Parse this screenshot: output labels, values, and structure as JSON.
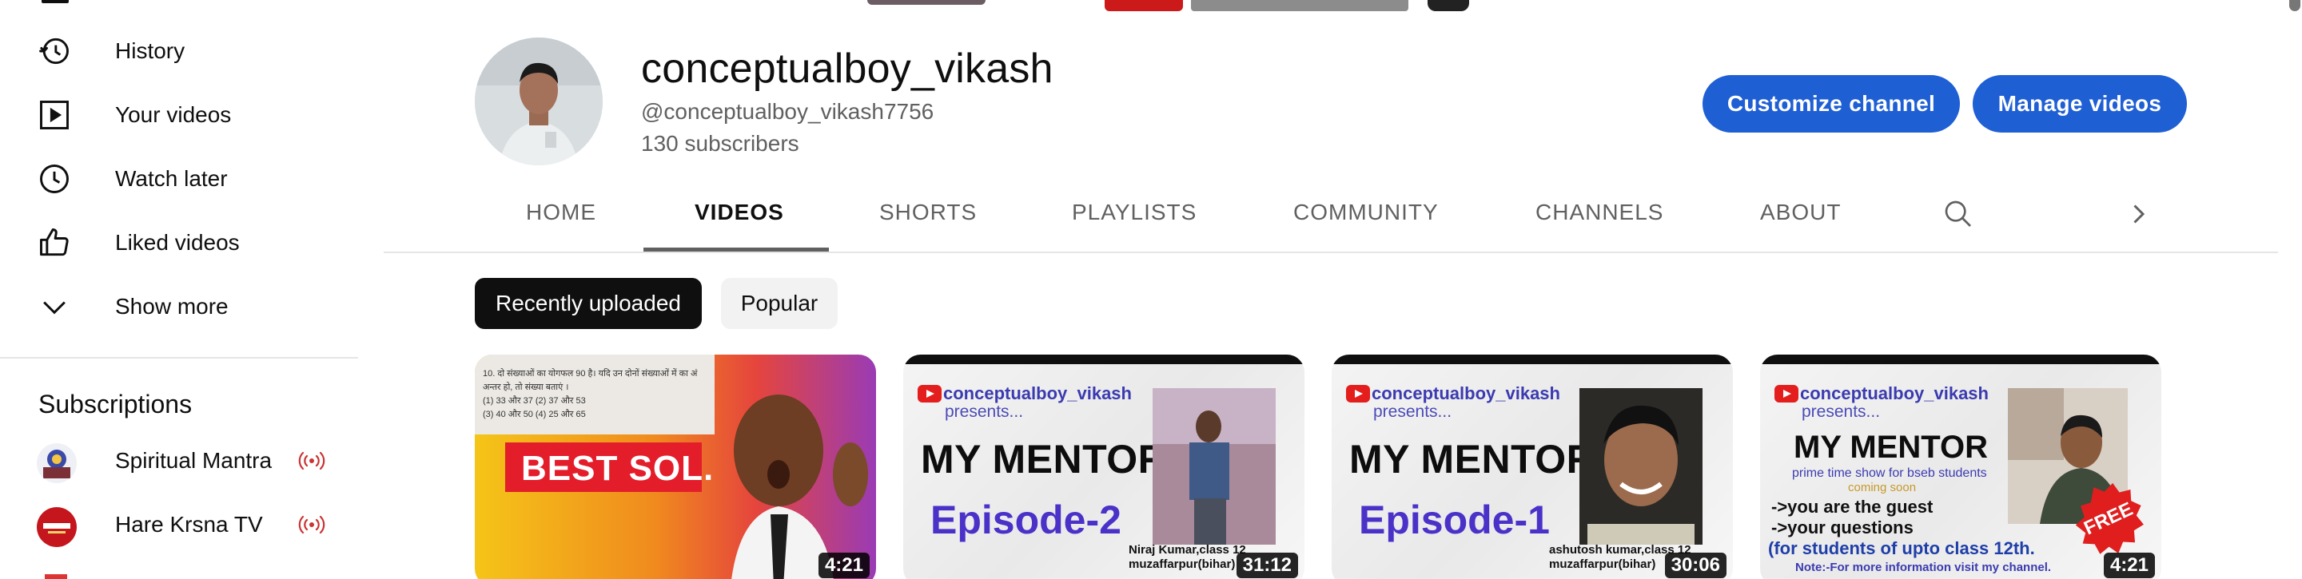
{
  "sidebar": {
    "items": [
      {
        "label": "History",
        "icon": "history-icon"
      },
      {
        "label": "Your videos",
        "icon": "your-videos-icon"
      },
      {
        "label": "Watch later",
        "icon": "watch-later-icon"
      },
      {
        "label": "Liked videos",
        "icon": "like-icon"
      },
      {
        "label": "Show more",
        "icon": "chevron-down-icon"
      }
    ],
    "subscriptions_title": "Subscriptions",
    "subscriptions": [
      {
        "label": "Spiritual Mantra",
        "live": true
      },
      {
        "label": "Hare Krsna TV",
        "live": true
      }
    ]
  },
  "channel": {
    "name": "conceptualboy_vikash",
    "handle": "@conceptualboy_vikash7756",
    "subscribers": "130 subscribers",
    "customize_label": "Customize channel",
    "manage_label": "Manage videos"
  },
  "tabs": [
    "HOME",
    "VIDEOS",
    "SHORTS",
    "PLAYLISTS",
    "COMMUNITY",
    "CHANNELS",
    "ABOUT"
  ],
  "active_tab": "VIDEOS",
  "chips": {
    "recent": "Recently uploaded",
    "popular": "Popular"
  },
  "videos": [
    {
      "duration": "4:21",
      "thumb_text": "BEST SOL.",
      "question_lines": [
        "10. दो संख्याओं का योगफल 90 है। यदि उन दोनों संख्याओं में का अं",
        "अन्तर हो, तो संख्या बताएं ।",
        "(1) 33 और 37      (2) 37 और 53",
        "(3) 40 और 50      (4) 25 और 65"
      ]
    },
    {
      "duration": "31:12",
      "brand": "conceptualboy_vikash",
      "presents": "presents...",
      "mentor": "MY MENTOR",
      "episode": "Episode-2",
      "caption": [
        "Niraj Kumar,class 12",
        "muzaffarpur(bihar)"
      ]
    },
    {
      "duration": "30:06",
      "brand": "conceptualboy_vikash",
      "presents": "presents...",
      "mentor": "MY MENTOR",
      "episode": "Episode-1",
      "caption": [
        "ashutosh kumar,class 12",
        "muzaffarpur(bihar)"
      ]
    },
    {
      "duration": "4:21",
      "brand": "conceptualboy_vikash",
      "presents": "presents...",
      "mentor": "MY MENTOR",
      "sub1": "prime time show for bseb students",
      "sub2": "coming soon",
      "line1": "->you are the guest",
      "line2": "->your questions",
      "line3": "(for students of upto class 12th.",
      "note": "Note:-For more information visit my channel.",
      "badge": "FREE"
    }
  ],
  "colors": {
    "accent": "#1f5fd4",
    "progress": "#ee0000",
    "live": "#cc3333"
  }
}
